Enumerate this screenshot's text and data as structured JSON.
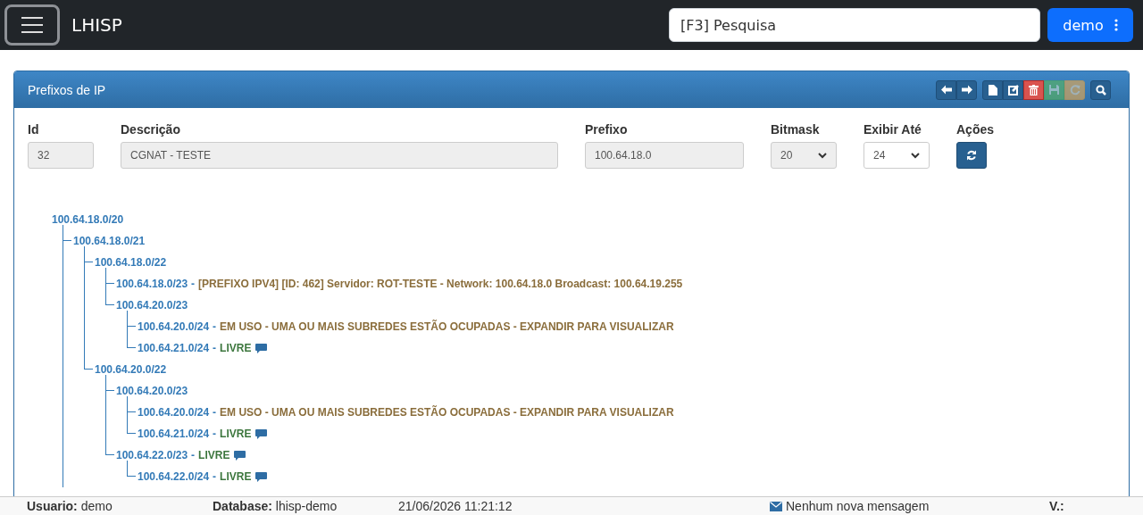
{
  "navbar": {
    "brand": "LHISP",
    "search": {
      "placeholder": "[F3] Pesquisa"
    },
    "user_button": "demo"
  },
  "panel": {
    "title": "Prefixos de IP",
    "toolbar": [
      [
        {
          "kind": "back",
          "disabled": false
        },
        {
          "kind": "forward",
          "disabled": false
        }
      ],
      [
        {
          "kind": "new",
          "disabled": false
        },
        {
          "kind": "edit",
          "disabled": false
        },
        {
          "kind": "delete",
          "disabled": false
        },
        {
          "kind": "save",
          "disabled": true
        },
        {
          "kind": "reload",
          "disabled": true
        }
      ],
      [
        {
          "kind": "search",
          "disabled": false
        }
      ]
    ],
    "form": [
      {
        "kind": "input",
        "label": "Id",
        "value": "32",
        "disabled": true
      },
      {
        "kind": "input",
        "label": "Descrição",
        "value": "CGNAT - TESTE",
        "disabled": true
      },
      {
        "kind": "input",
        "label": "Prefixo",
        "value": "100.64.18.0",
        "disabled": true
      },
      {
        "kind": "select",
        "label": "Bitmask",
        "value": "20",
        "disabled": true
      },
      {
        "kind": "select",
        "label": "Exibir Até",
        "value": "24",
        "disabled": false
      },
      {
        "kind": "button",
        "label": "Ações"
      }
    ],
    "tree": [
      {
        "prefix": "100.64.18.0/20",
        "children": [
          {
            "prefix": "100.64.18.0/21",
            "children": [
              {
                "prefix": "100.64.18.0/22",
                "children": [
                  {
                    "prefix": "100.64.18.0/23",
                    "separator": "-",
                    "color": "#8a6d3b",
                    "text": "[PREFIXO IPV4] [ID: 462] Servidor: ROT-TESTE - Network: 100.64.18.0 Broadcast: 100.64.19.255"
                  },
                  {
                    "prefix": "100.64.20.0/23",
                    "children": [
                      {
                        "prefix": "100.64.20.0/24",
                        "separator": "-",
                        "color": "#8a6d3b",
                        "text": "EM USO - UMA OU MAIS SUBREDES ESTÃO OCUPADAS - EXPANDIR PARA VISUALIZAR"
                      },
                      {
                        "prefix": "100.64.21.0/24",
                        "separator": "-",
                        "color": "#3c763d",
                        "text": "LIVRE",
                        "comment": true
                      }
                    ]
                  }
                ]
              },
              {
                "prefix": "100.64.20.0/22",
                "children": [
                  {
                    "prefix": "100.64.20.0/23",
                    "children": [
                      {
                        "prefix": "100.64.20.0/24",
                        "separator": "-",
                        "color": "#8a6d3b",
                        "text": "EM USO - UMA OU MAIS SUBREDES ESTÃO OCUPADAS - EXPANDIR PARA VISUALIZAR"
                      },
                      {
                        "prefix": "100.64.21.0/24",
                        "separator": "-",
                        "color": "#3c763d",
                        "text": "LIVRE",
                        "comment": true
                      }
                    ]
                  },
                  {
                    "prefix": "100.64.22.0/23",
                    "separator": "-",
                    "color": "#3c763d",
                    "text": "LIVRE",
                    "comment": true,
                    "children": [
                      {
                        "prefix": "100.64.22.0/24",
                        "separator": "-",
                        "color": "#3c763d",
                        "text": "LIVRE",
                        "comment": true
                      }
                    ]
                  }
                ]
              }
            ]
          }
        ]
      }
    ]
  },
  "status_bar": {
    "user_label": "Usuario:",
    "user": "demo",
    "database_label": "Database:",
    "database": "lhisp-demo",
    "datetime": "21/06/2026 11:21:12",
    "messages": "Nenhum nova mensagem",
    "version_label": "V.:"
  }
}
